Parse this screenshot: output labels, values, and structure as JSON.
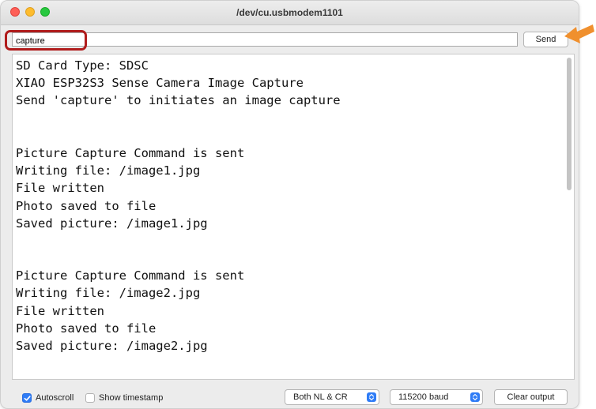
{
  "window": {
    "title": "/dev/cu.usbmodem1101"
  },
  "input": {
    "value": "capture",
    "send_label": "Send"
  },
  "output": {
    "lines": [
      "SD Card Type: SDSC",
      "XIAO ESP32S3 Sense Camera Image Capture",
      "Send 'capture' to initiates an image capture",
      "",
      "",
      "Picture Capture Command is sent",
      "Writing file: /image1.jpg",
      "File written",
      "Photo saved to file",
      "Saved picture: /image1.jpg",
      "",
      "",
      "Picture Capture Command is sent",
      "Writing file: /image2.jpg",
      "File written",
      "Photo saved to file",
      "Saved picture: /image2.jpg"
    ]
  },
  "statusbar": {
    "autoscroll_label": "Autoscroll",
    "autoscroll_checked": true,
    "timestamp_label": "Show timestamp",
    "timestamp_checked": false,
    "line_ending": "Both NL & CR",
    "baud_rate": "115200 baud",
    "clear_label": "Clear output"
  },
  "colors": {
    "highlight_box": "#b01c1c",
    "arrow": "#f0902e",
    "accent": "#2f7cf6"
  },
  "icons": {
    "arrow": "arrow-pointing-to-send-icon",
    "checkmark": "checkmark-icon",
    "stepper": "updown-chevron-icon"
  }
}
